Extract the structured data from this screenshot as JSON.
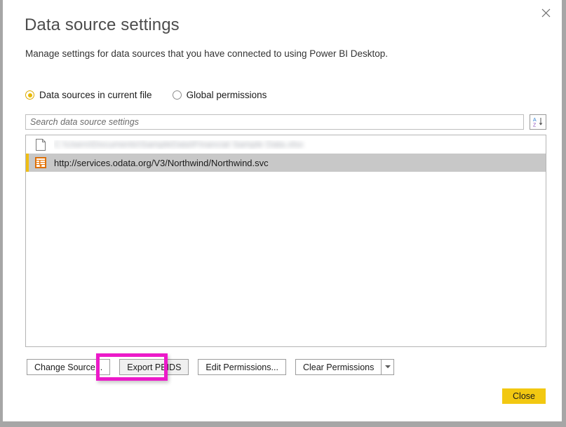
{
  "dialog": {
    "title": "Data source settings",
    "subtitle": "Manage settings for data sources that you have connected to using Power BI Desktop.",
    "close_icon": "close-icon"
  },
  "scope": {
    "options": [
      {
        "label": "Data sources in current file",
        "selected": true
      },
      {
        "label": "Global permissions",
        "selected": false
      }
    ]
  },
  "search": {
    "placeholder": "Search data source settings",
    "value": "",
    "sort_icon": "sort-az-icon",
    "sort_letters": {
      "top": "A",
      "bottom": "Z"
    }
  },
  "data_sources": [
    {
      "icon": "file-document-icon",
      "label": "C:\\Users\\Documents\\SampleData\\Financial Sample Data.xlsx",
      "redacted": true,
      "selected": false
    },
    {
      "icon": "odata-table-icon",
      "label": "http://services.odata.org/V3/Northwind/Northwind.svc",
      "redacted": false,
      "selected": true
    }
  ],
  "buttons": {
    "change_source": "Change Source...",
    "export_pbids": "Export PBIDS",
    "edit_permissions": "Edit Permissions...",
    "clear_permissions": "Clear Permissions",
    "clear_permissions_arrow": "chevron-down-icon",
    "close": "Close"
  },
  "annotation": {
    "target": "Export PBIDS",
    "color": "#ec1ac9"
  },
  "colors": {
    "accent": "#f2c811",
    "selection_bg": "#c8c8c8",
    "selection_bar": "#efbe14",
    "odata_icon": "#e8770a",
    "window_backdrop": "#a6a6a6",
    "annotation": "#ec1ac9"
  }
}
